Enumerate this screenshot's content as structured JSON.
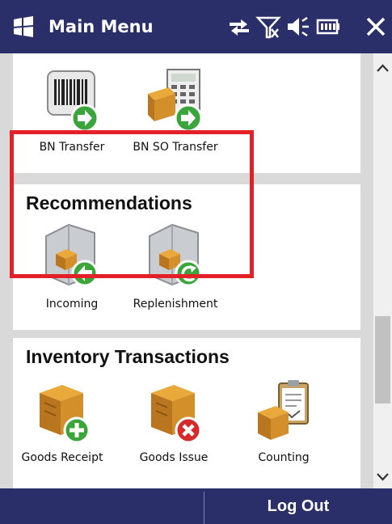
{
  "titlebar": {
    "title": "Main Menu",
    "icons": [
      "windows-logo",
      "connectivity-icon",
      "no-signal-icon",
      "volume-icon",
      "battery-icon",
      "close-icon"
    ]
  },
  "sections": {
    "transfer": {
      "tiles": [
        {
          "label": "BN Transfer",
          "icon": "barcode-transfer-icon"
        },
        {
          "label": "BN SO Transfer",
          "icon": "calculator-transfer-icon"
        }
      ]
    },
    "recommendations": {
      "title": "Recommendations",
      "tiles": [
        {
          "label": "Incoming",
          "icon": "warehouse-incoming-icon"
        },
        {
          "label": "Replenishment",
          "icon": "warehouse-replenish-icon"
        }
      ]
    },
    "inventory": {
      "title": "Inventory Transactions",
      "tiles": [
        {
          "label": "Goods Receipt",
          "icon": "box-add-icon"
        },
        {
          "label": "Goods Issue",
          "icon": "box-remove-icon"
        },
        {
          "label": "Counting",
          "icon": "clipboard-box-icon"
        }
      ]
    }
  },
  "softkeys": {
    "left": "",
    "right": "Log Out"
  },
  "colors": {
    "titlebar": "#2a2f6a",
    "highlight": "#e32027",
    "arrow_green": "#3aa53a",
    "remove_red": "#d42b2b"
  }
}
